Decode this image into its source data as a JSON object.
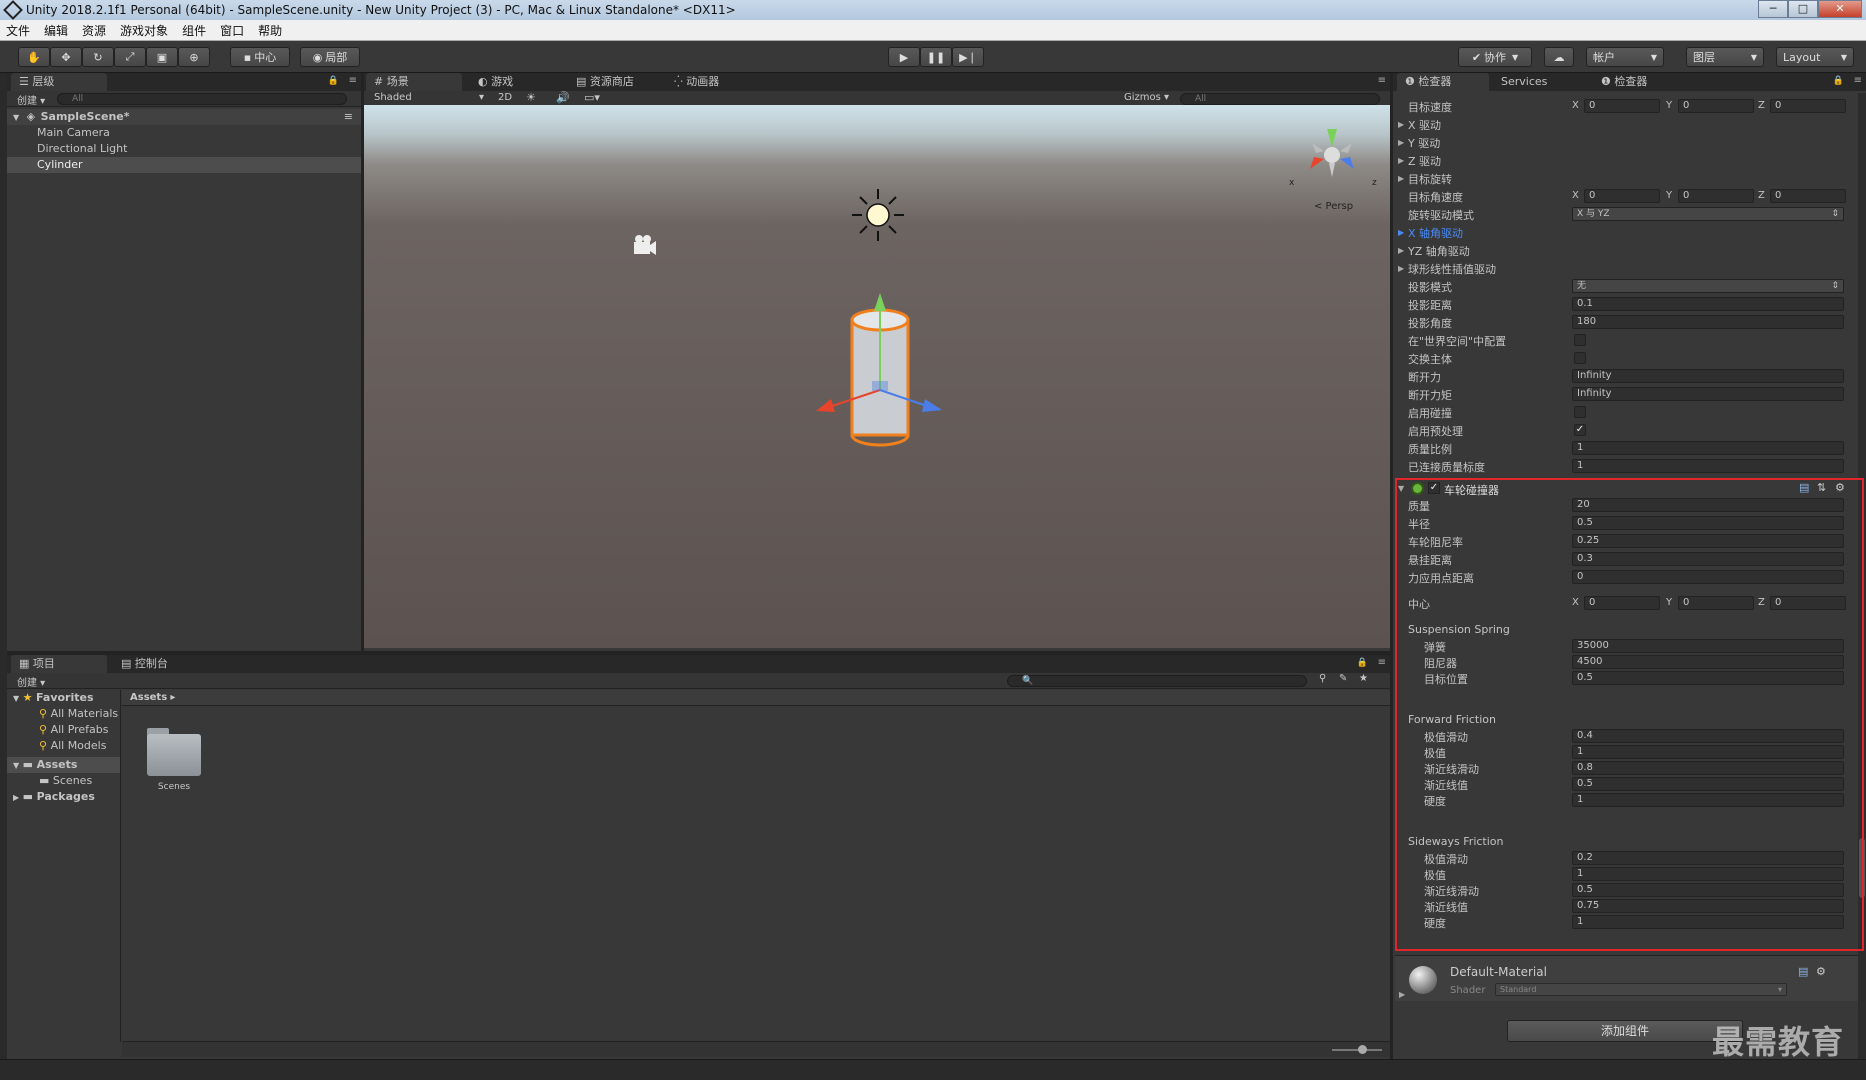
{
  "window": {
    "title": "Unity 2018.2.1f1 Personal (64bit) - SampleScene.unity - New Unity Project (3) - PC, Mac & Linux Standalone* <DX11>"
  },
  "menu": [
    "文件",
    "编辑",
    "资源",
    "游戏对象",
    "组件",
    "窗口",
    "帮助"
  ],
  "toolbar": {
    "pivot_label": "中心",
    "space_label": "局部",
    "collab_label": "协作",
    "account_label": "帐户",
    "layers_label": "图层",
    "layout_label": "Layout"
  },
  "hierarchy": {
    "tab": "层级",
    "create": "创建",
    "search_placeholder": "All",
    "scene": "SampleScene*",
    "items": [
      "Main Camera",
      "Directional Light",
      "Cylinder"
    ]
  },
  "scene_view": {
    "tabs": [
      "场景",
      "游戏",
      "资源商店",
      "动画器"
    ],
    "shading": "Shaded",
    "mode_2d": "2D",
    "gizmos": "Gizmos",
    "search_placeholder": "All",
    "persp": "< Persp",
    "axis_x": "x",
    "axis_z": "z"
  },
  "project": {
    "tabs": [
      "项目",
      "控制台"
    ],
    "create": "创建",
    "favorites": "Favorites",
    "fav_items": [
      "All Materials",
      "All Prefabs",
      "All Models"
    ],
    "assets": "Assets",
    "asset_children": [
      "Scenes"
    ],
    "packages": "Packages",
    "breadcrumb": "Assets",
    "folder": "Scenes"
  },
  "inspector": {
    "tabs": [
      "检查器",
      "Services",
      "检查器"
    ],
    "top_rows": [
      {
        "label": "目标速度",
        "type": "vec",
        "x": "0",
        "y": "0",
        "z": "0"
      },
      {
        "label": "X 驱动",
        "type": "fold"
      },
      {
        "label": "Y 驱动",
        "type": "fold"
      },
      {
        "label": "Z 驱动",
        "type": "fold"
      },
      {
        "label": "目标旋转",
        "type": "fold"
      },
      {
        "label": "目标角速度",
        "type": "vec",
        "x": "0",
        "y": "0",
        "z": "0"
      },
      {
        "label": "旋转驱动模式",
        "type": "select",
        "value": "X 与 YZ"
      },
      {
        "label": "X 轴角驱动",
        "type": "fold",
        "highlight": true
      },
      {
        "label": "YZ 轴角驱动",
        "type": "fold"
      },
      {
        "label": "球形线性插值驱动",
        "type": "fold"
      },
      {
        "label": "投影模式",
        "type": "select",
        "value": "无"
      },
      {
        "label": "投影距离",
        "type": "field",
        "value": "0.1"
      },
      {
        "label": "投影角度",
        "type": "field",
        "value": "180"
      },
      {
        "label": "在\"世界空间\"中配置",
        "type": "check",
        "checked": false
      },
      {
        "label": "交换主体",
        "type": "check",
        "checked": false
      },
      {
        "label": "断开力",
        "type": "field",
        "value": "Infinity"
      },
      {
        "label": "断开力矩",
        "type": "field",
        "value": "Infinity"
      },
      {
        "label": "启用碰撞",
        "type": "check",
        "checked": false
      },
      {
        "label": "启用预处理",
        "type": "check",
        "checked": true
      },
      {
        "label": "质量比例",
        "type": "field",
        "value": "1"
      },
      {
        "label": "已连接质量标度",
        "type": "field",
        "value": "1"
      }
    ],
    "wheel_collider": {
      "title": "车轮碰撞器",
      "fields": [
        {
          "label": "质量",
          "value": "20"
        },
        {
          "label": "半径",
          "value": "0.5"
        },
        {
          "label": "车轮阻尼率",
          "value": "0.25"
        },
        {
          "label": "悬挂距离",
          "value": "0.3"
        },
        {
          "label": "力应用点距离",
          "value": "0"
        }
      ],
      "center_label": "中心",
      "center": {
        "x": "0",
        "y": "0",
        "z": "0"
      },
      "suspension": {
        "title": "Suspension Spring",
        "fields": [
          {
            "label": "弹簧",
            "value": "35000"
          },
          {
            "label": "阻尼器",
            "value": "4500"
          },
          {
            "label": "目标位置",
            "value": "0.5"
          }
        ]
      },
      "forward": {
        "title": "Forward Friction",
        "fields": [
          {
            "label": "极值滑动",
            "value": "0.4"
          },
          {
            "label": "极值",
            "value": "1"
          },
          {
            "label": "渐近线滑动",
            "value": "0.8"
          },
          {
            "label": "渐近线值",
            "value": "0.5"
          },
          {
            "label": "硬度",
            "value": "1"
          }
        ]
      },
      "sideways": {
        "title": "Sideways Friction",
        "fields": [
          {
            "label": "极值滑动",
            "value": "0.2"
          },
          {
            "label": "极值",
            "value": "1"
          },
          {
            "label": "渐近线滑动",
            "value": "0.5"
          },
          {
            "label": "渐近线值",
            "value": "0.75"
          },
          {
            "label": "硬度",
            "value": "1"
          }
        ]
      }
    },
    "material": {
      "name": "Default-Material",
      "shader_label": "Shader",
      "shader_value": "Standard"
    },
    "add_component": "添加组件",
    "watermark": "最需教育"
  },
  "colors": {
    "highlight_red": "#e0262b",
    "selection_blue": "#4a8bf5",
    "accent_orange": "#f07f1e"
  }
}
